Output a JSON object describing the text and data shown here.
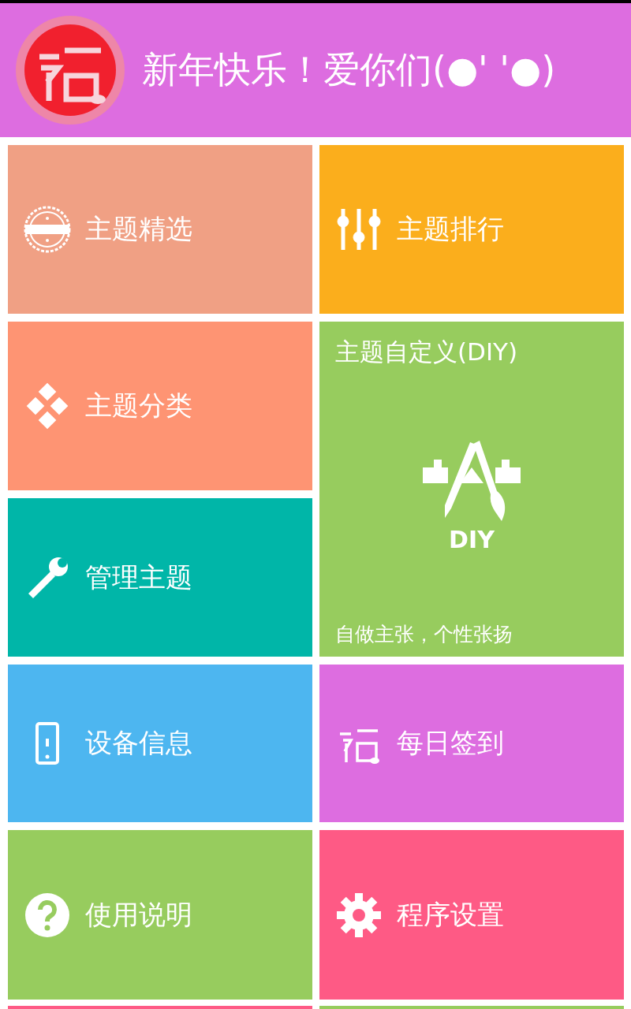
{
  "header": {
    "marquee": "新年快乐！爱你们(●' '●)"
  },
  "tiles": [
    {
      "kind": "tile",
      "label": "主题精选",
      "color": "#f0a084"
    },
    {
      "kind": "tile",
      "label": "主题排行",
      "color": "#fbae1c"
    },
    {
      "kind": "tile",
      "label": "主题分类",
      "color": "#fe9473"
    },
    {
      "kind": "feature",
      "label": "主题自定义(DIY)",
      "icon_label": "DIY",
      "caption": "自做主张，个性张扬",
      "color": "#97cc5e"
    },
    {
      "kind": "tile",
      "label": "管理主题",
      "color": "#00b6a8"
    },
    {
      "kind": "tile",
      "label": "设备信息",
      "color": "#4db6f0"
    },
    {
      "kind": "tile",
      "label": "每日签到",
      "color": "#dd6de0"
    },
    {
      "kind": "tile",
      "label": "使用说明",
      "color": "#97cc5e"
    },
    {
      "kind": "tile",
      "label": "程序设置",
      "color": "#fe5a85"
    },
    {
      "kind": "stub",
      "color": "#fe5a85"
    },
    {
      "kind": "stub",
      "color": "#97cc5e"
    }
  ]
}
